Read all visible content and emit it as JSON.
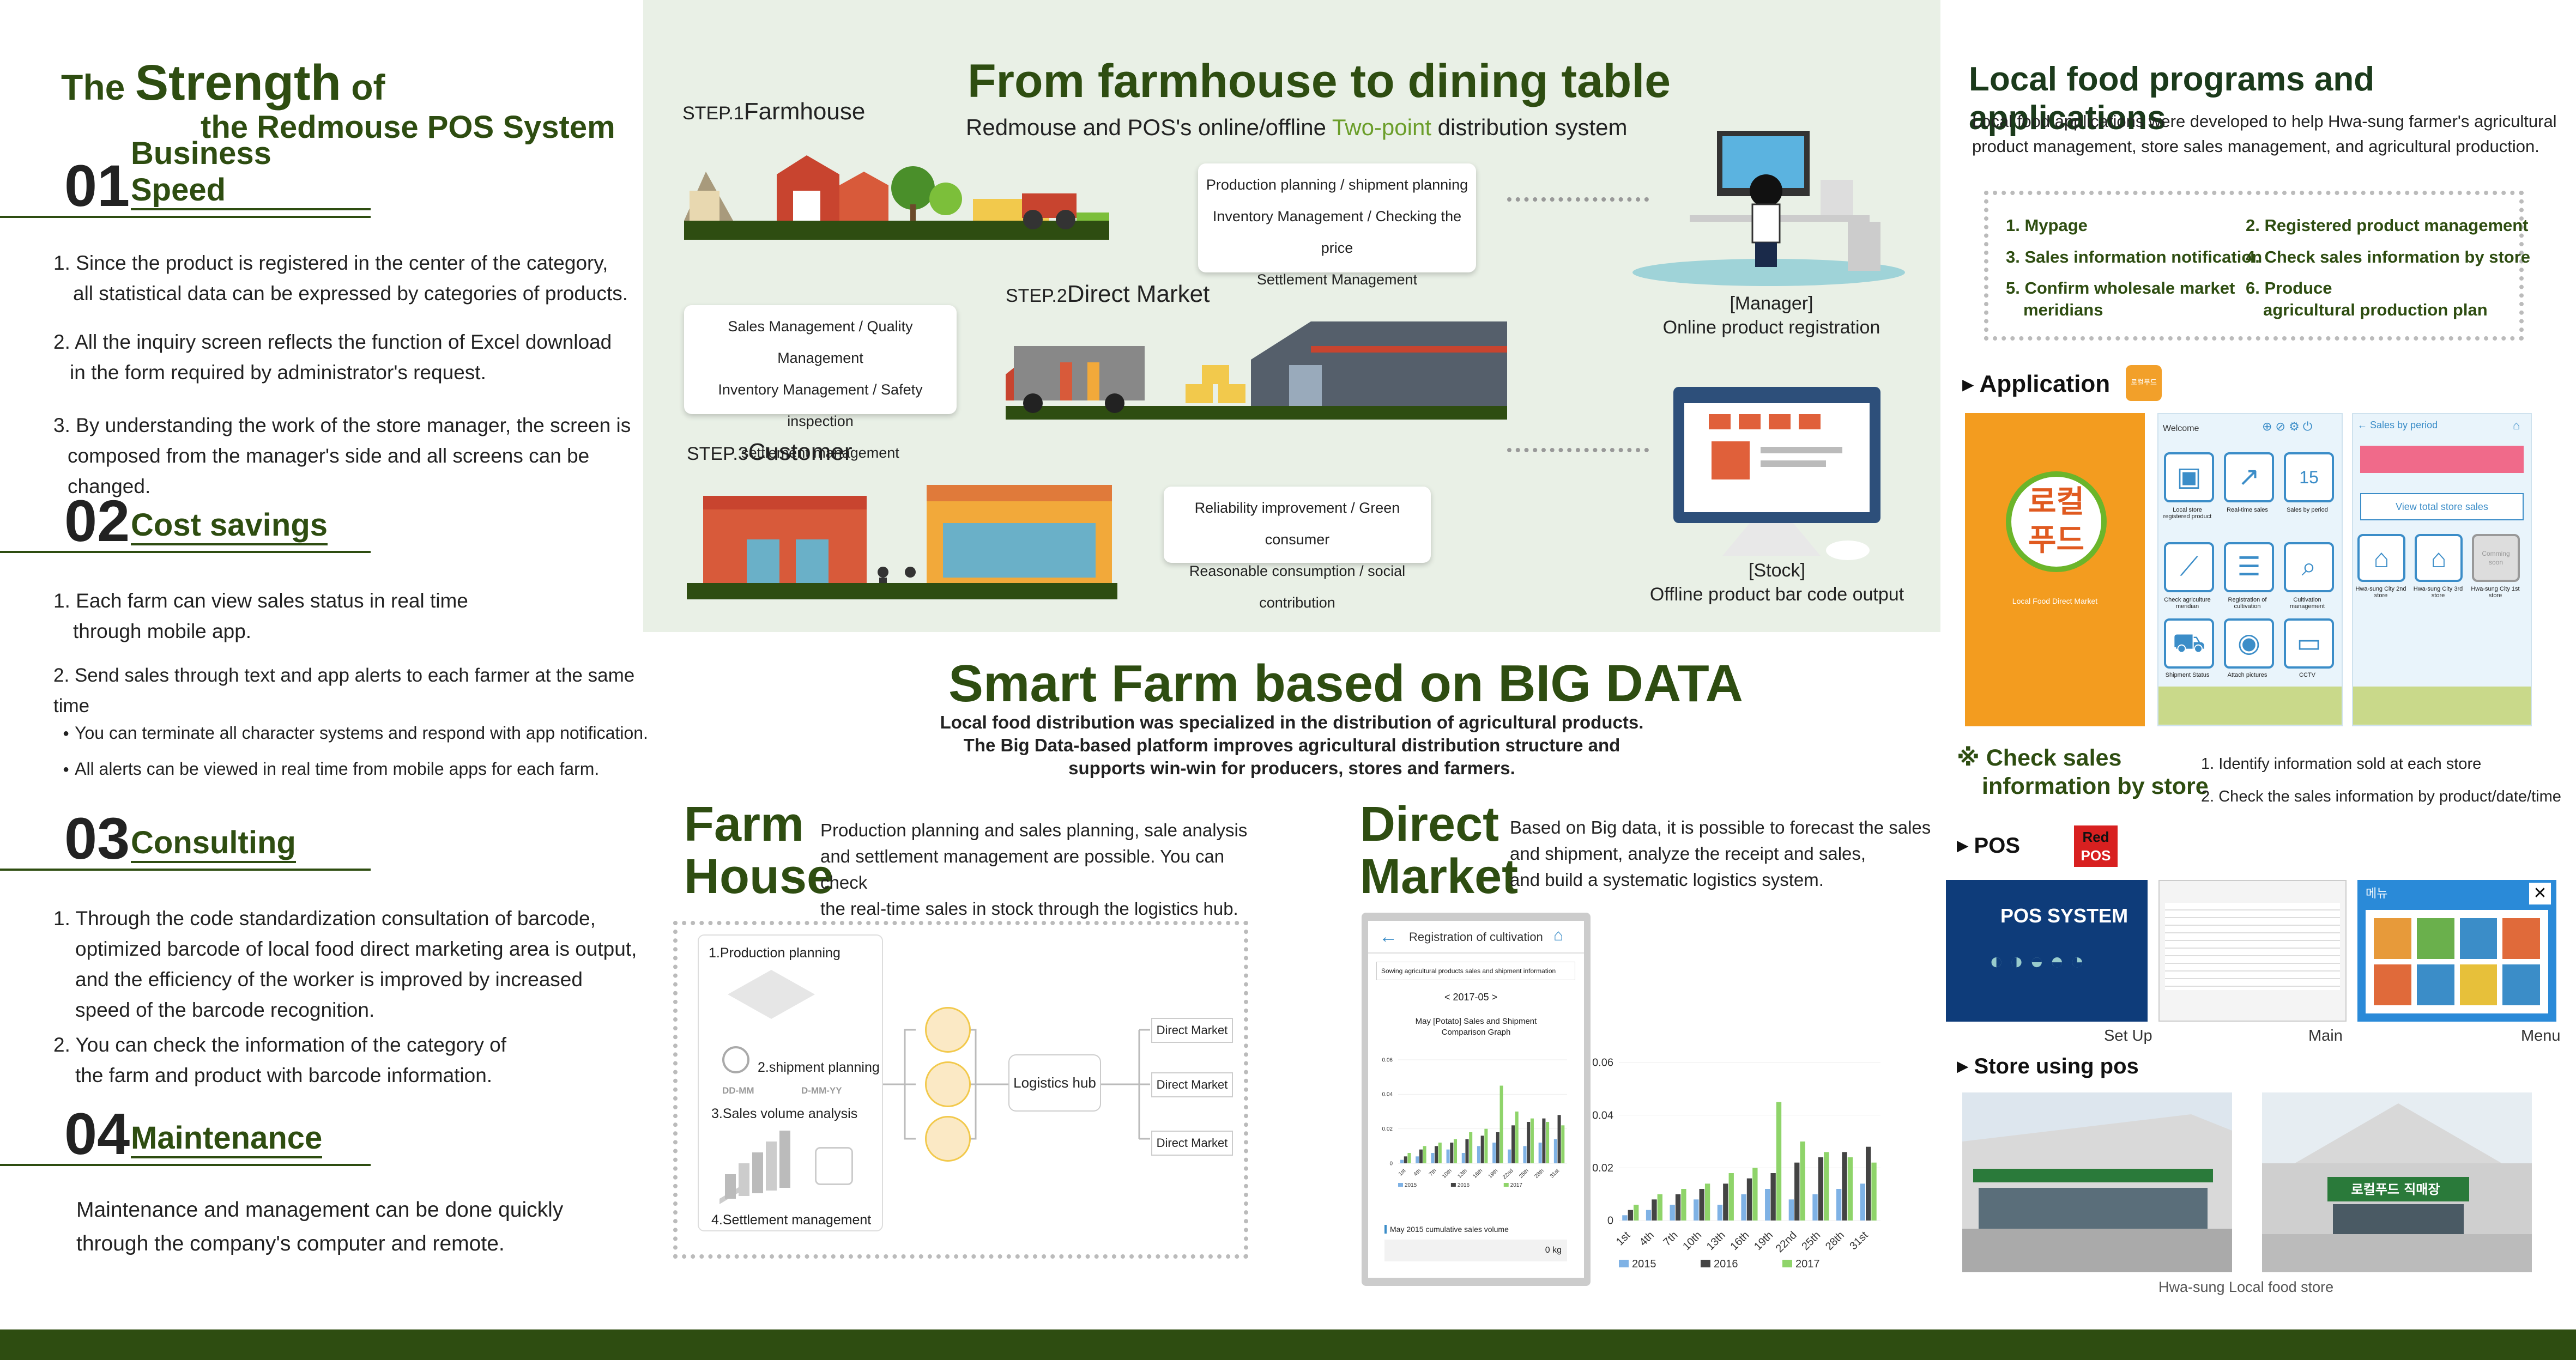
{
  "left": {
    "title_pre": "The",
    "title_big": "Strength",
    "title_post": "of",
    "title_line2": "the Redmouse POS System",
    "sections": [
      {
        "num": "01",
        "label": "Business Speed",
        "items": [
          {
            "n": "1.",
            "lines": [
              "Since the product is registered in the center of the category,",
              "all statistical data can be expressed by categories of products."
            ]
          },
          {
            "n": "2.",
            "lines": [
              "All the inquiry screen reflects the function of Excel download",
              "in the form required by administrator's request."
            ]
          },
          {
            "n": "3.",
            "lines": [
              "By understanding the work of the store manager, the screen is",
              "composed from the manager's side and all screens can be changed."
            ]
          }
        ]
      },
      {
        "num": "02",
        "label": "Cost savings",
        "items": [
          {
            "n": "1.",
            "lines": [
              "Each farm can view sales status in real time",
              "through mobile app."
            ]
          },
          {
            "n": "2.",
            "lines": [
              "Send sales through text and app alerts to each farmer at the same time"
            ]
          }
        ],
        "bullets": [
          "You can terminate all character systems and respond with app notification.",
          "All alerts can be viewed in real time from mobile apps for each farm."
        ]
      },
      {
        "num": "03",
        "label": "Consulting",
        "items": [
          {
            "n": "1.",
            "lines": [
              "Through the code standardization consultation of barcode,",
              "optimized barcode of local food direct marketing area is output,",
              "and the efficiency of the worker is improved by increased",
              "speed of the barcode recognition."
            ]
          },
          {
            "n": "2.",
            "lines": [
              "You can check the information of the category of",
              "the farm and product with barcode information."
            ]
          }
        ]
      },
      {
        "num": "04",
        "label": "Maintenance",
        "items": [
          {
            "n": "",
            "lines": [
              "Maintenance and management can be done quickly",
              "through the company's computer and remote."
            ]
          }
        ]
      }
    ]
  },
  "center_top": {
    "title": "From farmhouse to dining table",
    "subtitle_pre": "Redmouse and POS's online/offline ",
    "subtitle_hl": "Two-point",
    "subtitle_post": " distribution system",
    "steps": [
      {
        "prefix": "STEP.1",
        "name": "Farmhouse"
      },
      {
        "prefix": "STEP.2",
        "name": "Direct Market"
      },
      {
        "prefix": "STEP.3",
        "name": "Customer"
      }
    ],
    "bubble1": [
      "Production planning / shipment planning",
      "Inventory Management / Checking the price",
      "Settlement Management"
    ],
    "bubble2": [
      "Sales Management / Quality Management",
      "Inventory Management / Safety inspection",
      "settlement management"
    ],
    "bubble3": [
      "Reliability improvement / Green consumer",
      "Reasonable consumption / social contribution"
    ],
    "manager_caption": [
      "[Manager]",
      "Online product registration"
    ],
    "stock_caption": [
      "[Stock]",
      "Offline product bar code output"
    ]
  },
  "bigdata": {
    "title": "Smart Farm based on BIG DATA",
    "subtitle": [
      "Local food distribution was specialized in the distribution of agricultural products.",
      "The Big Data-based platform improves agricultural distribution structure and",
      "supports win-win for producers, stores and farmers."
    ],
    "farm_title": [
      "Farm",
      "House"
    ],
    "farm_desc": [
      "Production planning and sales planning, sale analysis",
      "and settlement management are possible. You can check",
      "the real-time sales in stock through the logistics hub."
    ],
    "market_title": [
      "Direct",
      "Market"
    ],
    "market_desc": [
      "Based on Big data, it is possible to forecast the sales",
      "and shipment, analyze the receipt and sales,",
      "and build a systematic logistics system."
    ],
    "flow": {
      "steps": [
        "1.Production planning",
        "2.shipment planning",
        "3.Sales volume analysis",
        "4.Settlement management"
      ],
      "date_labels": [
        "DD-MM",
        "D-MM-YY"
      ],
      "hub": "Logistics hub",
      "markets": [
        "Direct Market",
        "Direct Market",
        "Direct Market"
      ]
    },
    "phone": {
      "header": "Registration of cultivation",
      "dropdown": "Sowing agricultural products sales and shipment information",
      "date": "2017-05",
      "graph_title": [
        "May [Potato] Sales and Shipment",
        "Comparison Graph"
      ],
      "footer_label": "May 2015 cumulative sales volume",
      "footer_value": "0 kg"
    }
  },
  "chart_data": {
    "type": "bar",
    "title": "",
    "ylim": [
      0,
      0.06
    ],
    "yticks": [
      "0",
      "0.02",
      "0.04",
      "0.06"
    ],
    "xticks": [
      "1st",
      "4th",
      "7th",
      "10th",
      "13th",
      "16th",
      "19th",
      "22nd",
      "25th",
      "28th",
      "31st"
    ],
    "series": [
      {
        "name": "2015",
        "color": "#7fb2e5",
        "values": [
          0.002,
          0.004,
          0.006,
          0.008,
          0.006,
          0.01,
          0.012,
          0.008,
          0.01,
          0.012,
          0.014
        ]
      },
      {
        "name": "2016",
        "color": "#444444",
        "values": [
          0.004,
          0.008,
          0.01,
          0.012,
          0.014,
          0.016,
          0.018,
          0.022,
          0.024,
          0.026,
          0.028
        ]
      },
      {
        "name": "2017",
        "color": "#8fd46a",
        "values": [
          0.006,
          0.01,
          0.012,
          0.014,
          0.018,
          0.02,
          0.045,
          0.03,
          0.026,
          0.024,
          0.022
        ]
      }
    ]
  },
  "right": {
    "title": "Local food programs and applications",
    "subtitle": [
      "Local food applications were developed to help Hwa-sung farmer's  agricultural",
      "product management, store sales management, and agricultural production."
    ],
    "programs_left": [
      "1. Mypage",
      "3. Sales information notification",
      "5. Confirm wholesale market",
      "meridians"
    ],
    "programs_right": [
      "2. Registered product management",
      "4. Check sales information by store",
      "6. Produce",
      "agricultural production plan"
    ],
    "application_label": "Application",
    "app_badge": "로컬푸드",
    "app_splash_logo": [
      "로컬",
      "푸드"
    ],
    "app_splash_sub": "Local Food Direct Market",
    "app_welcome": "Welcome",
    "app_icons": [
      "Local store registered product",
      "Real-time sales",
      "Sales by period",
      "Check agriculture meridian",
      "Registration of cultivation",
      "Cultivation management",
      "Shipment Status",
      "Attach pictures",
      "CCTV"
    ],
    "app_sales_header": "Sales by period",
    "app_sales_btn": "View total store sales",
    "app_stores": [
      "Hwa-sung City 2nd store",
      "Hwa-sung City 3rd store",
      "Hwa-sung City 1st store"
    ],
    "app_coming": "Comming soon",
    "check_title": [
      "※ Check sales",
      "information by store"
    ],
    "check_items": [
      "1. Identify information sold at each store",
      "2. Check the sales information by product/date/time"
    ],
    "pos_label": "POS",
    "pos_logo": [
      "Red",
      "POS"
    ],
    "pos_system": "POS SYSTEM",
    "pos_captions": [
      "Set Up",
      "Main",
      "Menu"
    ],
    "pos_menu_title": "메뉴",
    "store_label": "Store using pos",
    "store_sign": "로컬푸드 직매장",
    "store_caption": "Hwa-sung Local food store"
  }
}
